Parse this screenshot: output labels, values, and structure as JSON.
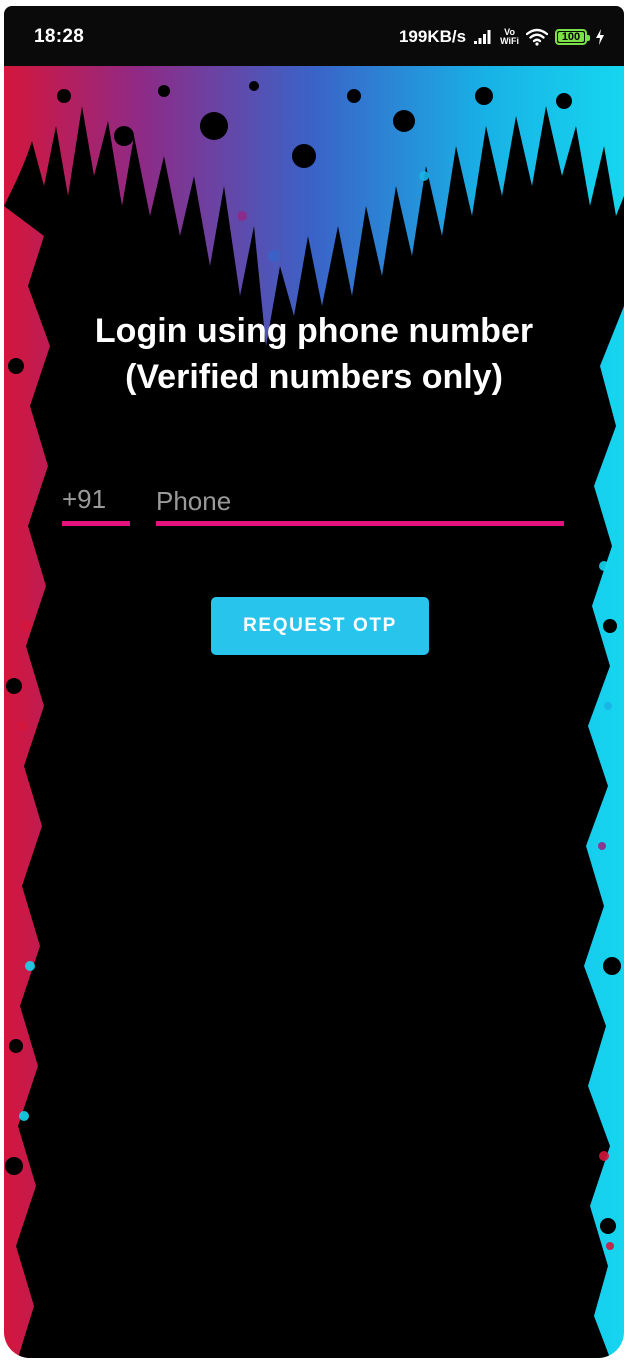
{
  "status_bar": {
    "time": "18:28",
    "net_speed": "199KB/s",
    "vowifi_top": "Vo",
    "vowifi_bottom": "WiFi",
    "battery_level": "100",
    "icons": [
      "signal-icon",
      "vowifi-icon",
      "wifi-icon",
      "battery-icon",
      "charging-icon"
    ]
  },
  "login": {
    "title_line1": "Login using phone number",
    "title_line2": "(Verified numbers only)",
    "country_code": "+91",
    "phone_placeholder": "Phone",
    "phone_value": "",
    "request_otp_label": "REQUEST OTP"
  },
  "colors": {
    "underline": "#e4127c",
    "button": "#28c4ec",
    "background": "#000000",
    "splash_gradient": [
      "#d4163c",
      "#8f2a86",
      "#3a63c8",
      "#18b2e6",
      "#16d6ef"
    ],
    "battery": "#7ce04a"
  }
}
